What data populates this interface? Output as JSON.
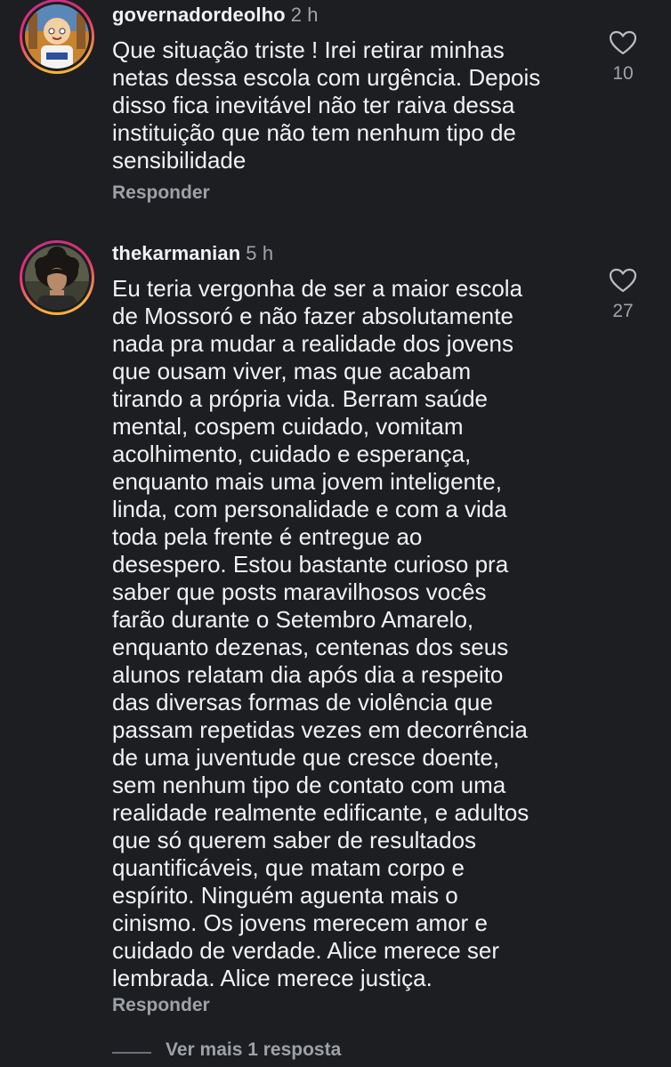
{
  "comments": [
    {
      "username": "governadordeolho",
      "time": "2 h",
      "text": "Que situação triste ! Irei retirar minhas\nnetas dessa escola com urgência. Depois\ndisso fica inevitável não ter raiva dessa\ninstituição que não tem nenhum tipo de\nsensibilidade",
      "reply_label": "Responder",
      "likes": "10",
      "avatar_icon": "cartoon-avatar"
    },
    {
      "username": "thekarmanian",
      "time": "5 h",
      "text": "Eu teria vergonha de ser a maior escola\nde Mossoró e não fazer absolutamente\nnada pra mudar a realidade dos jovens\nque ousam viver, mas que acabam\ntirando a própria vida. Berram saúde\nmental, cospem cuidado, vomitam\nacolhimento, cuidado e esperança,\nenquanto mais uma jovem inteligente,\nlinda, com personalidade e com a vida\ntoda pela frente é entregue ao\ndesespero. Estou bastante curioso pra\nsaber que posts maravilhosos vocês\nfarão durante o Setembro Amarelo,\nenquanto dezenas, centenas dos seus\nalunos relatam dia após dia a respeito\ndas diversas formas de violência que\npassam repetidas vezes em decorrência\nde uma juventude que cresce doente,\nsem nenhum tipo de contato com uma\nrealidade realmente edificante, e adultos\nque só querem saber de resultados\nquantificáveis, que matam corpo e\nespírito. Ninguém aguenta mais o\ncinismo. Os jovens merecem amor e\ncuidado de verdade. Alice merece ser\nlembrada. Alice merece justiça.",
      "reply_label": "Responder",
      "likes": "27",
      "avatar_icon": "profile-photo-avatar"
    }
  ],
  "view_more_replies": "Ver mais 1 resposta",
  "colors": {
    "background": "#1c1e22",
    "text": "#f2f2f2",
    "muted": "#a0a3a8",
    "story_ring_start": "#f9b233",
    "story_ring_end": "#ee2a7b"
  }
}
